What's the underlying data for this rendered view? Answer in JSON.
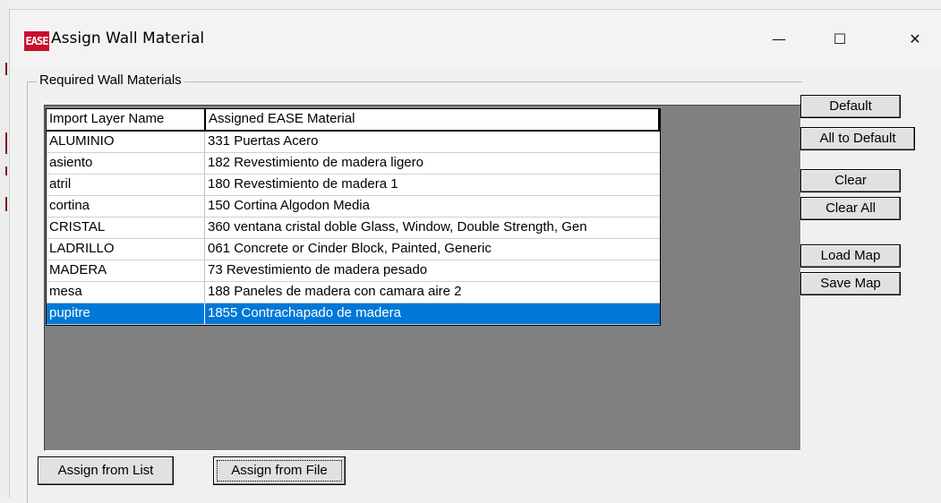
{
  "window": {
    "logo": "EASE",
    "title": "Assign Wall Material",
    "controls": {
      "minimize": "—",
      "maximize": "☐",
      "close": "✕"
    }
  },
  "group_label": "Required Wall Materials",
  "table": {
    "headers": [
      "Import Layer Name",
      "Assigned EASE Material"
    ],
    "rows": [
      {
        "layer": "ALUMINIO",
        "material": "331 Puertas Acero"
      },
      {
        "layer": "asiento",
        "material": "182 Revestimiento de madera ligero"
      },
      {
        "layer": "atril",
        "material": "180 Revestimiento de madera 1"
      },
      {
        "layer": "cortina",
        "material": "150 Cortina Algodon Media"
      },
      {
        "layer": "CRISTAL",
        "material": "360 ventana cristal doble Glass, Window, Double Strength, Gen"
      },
      {
        "layer": "LADRILLO",
        "material": "061 Concrete or Cinder Block, Painted, Generic"
      },
      {
        "layer": "MADERA",
        "material": "73 Revestimiento de madera pesado"
      },
      {
        "layer": "mesa",
        "material": "188 Paneles de madera con camara aire 2"
      },
      {
        "layer": "pupitre",
        "material": "1855 Contrachapado de madera"
      }
    ],
    "selected_row": "pupitre"
  },
  "buttons": {
    "default": "Default",
    "all_to_default": "All to Default",
    "clear": "Clear",
    "clear_all": "Clear All",
    "load_map": "Load Map",
    "save_map": "Save Map",
    "assign_from_list": "Assign from List",
    "assign_from_file": "Assign from File"
  },
  "colors": {
    "selection": "#0078d7",
    "logo": "#c8102e",
    "list_background": "#808080"
  }
}
